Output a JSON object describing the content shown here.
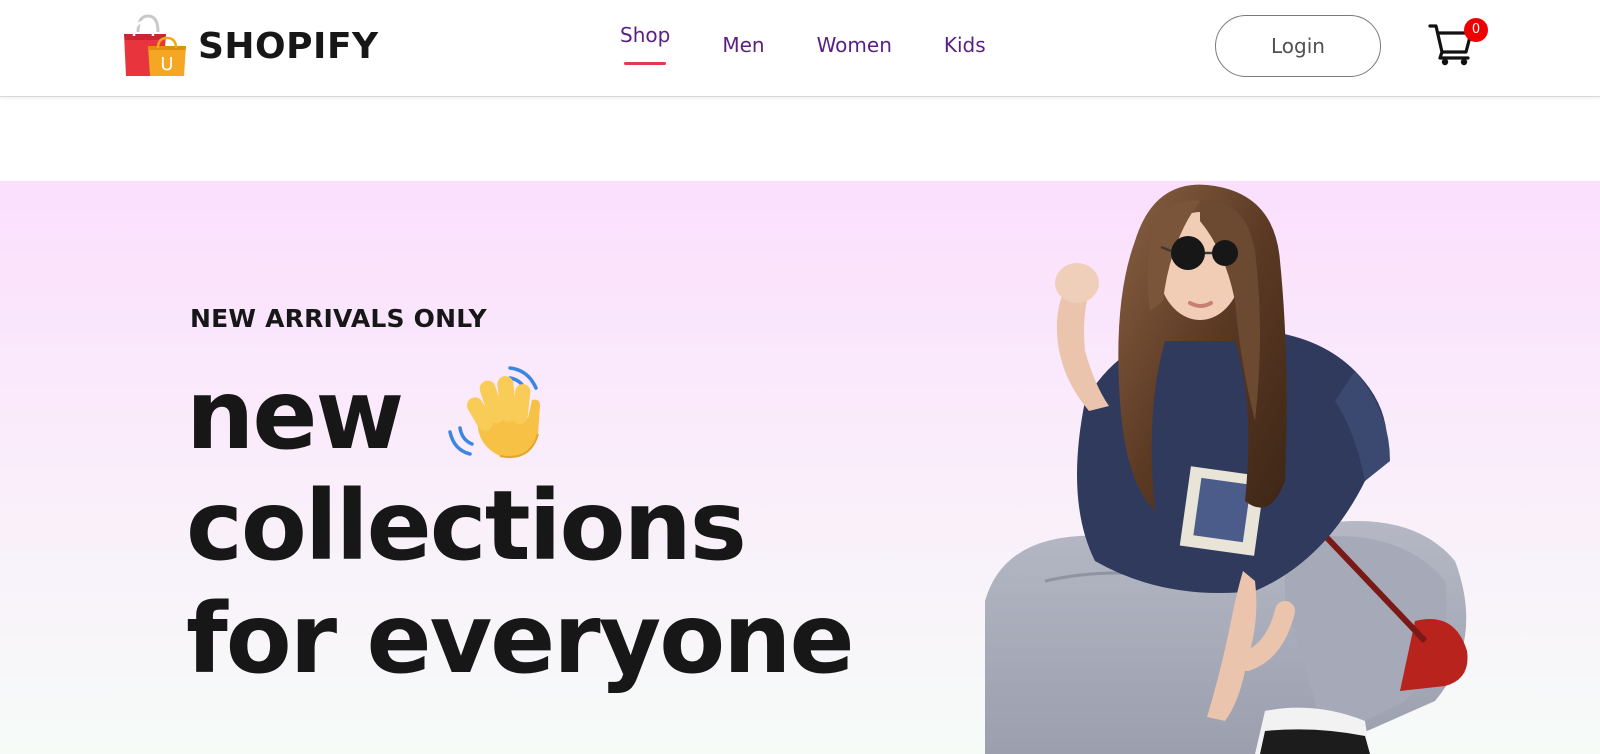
{
  "brand": {
    "name": "SHOPIFY",
    "logo_icon": "shopping-bag-icon",
    "logo_letter": "U"
  },
  "nav": {
    "items": [
      {
        "label": "Shop",
        "active": true
      },
      {
        "label": "Men",
        "active": false
      },
      {
        "label": "Women",
        "active": false
      },
      {
        "label": "Kids",
        "active": false
      }
    ]
  },
  "actions": {
    "login_label": "Login",
    "cart_icon": "shopping-cart-icon",
    "cart_count": "0"
  },
  "hero": {
    "eyebrow": "NEW ARRIVALS ONLY",
    "headline_line_1": "new",
    "headline_line_2": "collections",
    "headline_line_3": "for everyone",
    "hand_icon": "waving-hand-icon",
    "figure": "model-photo"
  },
  "colors": {
    "nav_link": "#5a2184",
    "active_underline": "#e23a4b",
    "cart_badge": "#ee0000",
    "hero_gradient_top": "#fbdffd",
    "hero_gradient_bottom": "#f6fbf8",
    "headline": "#171717"
  }
}
